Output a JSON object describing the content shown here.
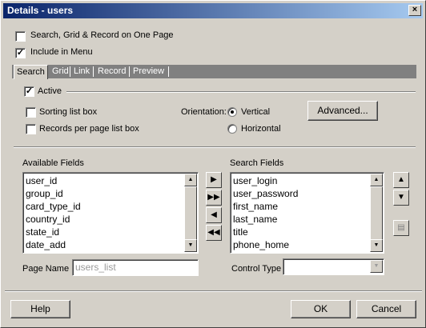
{
  "window": {
    "title": "Details - users",
    "close_glyph": "×"
  },
  "options": {
    "search_grid_record": "Search, Grid & Record on One Page",
    "include_in_menu": "Include in Menu",
    "include_in_menu_checked": true,
    "search_grid_record_checked": false
  },
  "tabs": [
    {
      "label": "Search",
      "active": true
    },
    {
      "label": "Grid"
    },
    {
      "label": "Link"
    },
    {
      "label": "Record"
    },
    {
      "label": "Preview"
    }
  ],
  "search_panel": {
    "active_label": "Active",
    "active_checked": true,
    "sorting_label": "Sorting list box",
    "records_label": "Records per page list box",
    "orientation_label": "Orientation:",
    "vertical_label": "Vertical",
    "horizontal_label": "Horizontal",
    "orientation_selected": "Vertical",
    "advanced_label": "Advanced..."
  },
  "available_fields": {
    "label": "Available Fields",
    "items": [
      "user_id",
      "group_id",
      "card_type_id",
      "country_id",
      "state_id",
      "date_add"
    ]
  },
  "search_fields": {
    "label": "Search Fields",
    "items": [
      "user_login",
      "user_password",
      "first_name",
      "last_name",
      "title",
      "phone_home"
    ]
  },
  "page_name": {
    "label": "Page Name",
    "value": "users_list"
  },
  "control_type": {
    "label": "Control Type",
    "value": ""
  },
  "footer": {
    "help": "Help",
    "ok": "OK",
    "cancel": "Cancel"
  },
  "icons": {
    "move_right": "move-right-icon",
    "move_all_right": "move-all-right-icon",
    "move_left": "move-left-icon",
    "move_all_left": "move-all-left-icon",
    "move_up": "move-up-icon",
    "move_down": "move-down-icon",
    "properties": "properties-icon"
  }
}
